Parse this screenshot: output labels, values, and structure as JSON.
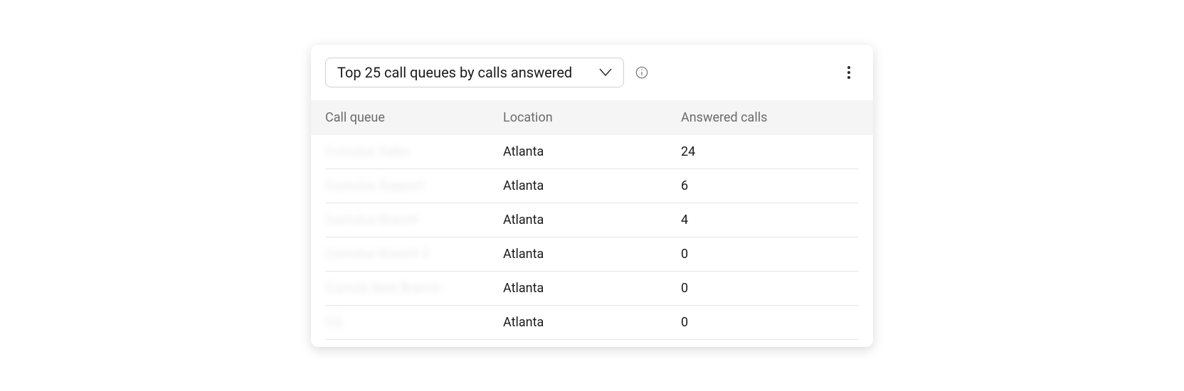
{
  "header": {
    "dropdown_label": "Top 25 call queues by calls answered"
  },
  "table": {
    "columns": {
      "queue": "Call queue",
      "location": "Location",
      "answered": "Answered calls"
    },
    "rows": [
      {
        "queue": "Cumulus Sales",
        "location": "Atlanta",
        "answered": "24"
      },
      {
        "queue": "Cumulus Support",
        "location": "Atlanta",
        "answered": "6"
      },
      {
        "queue": "Cumulus Branch",
        "location": "Atlanta",
        "answered": "4"
      },
      {
        "queue": "Cumulus Branch 2",
        "location": "Atlanta",
        "answered": "0"
      },
      {
        "queue": "Cumuls New Branch",
        "location": "Atlanta",
        "answered": "0"
      },
      {
        "queue": "CQ",
        "location": "Atlanta",
        "answered": "0"
      }
    ]
  }
}
